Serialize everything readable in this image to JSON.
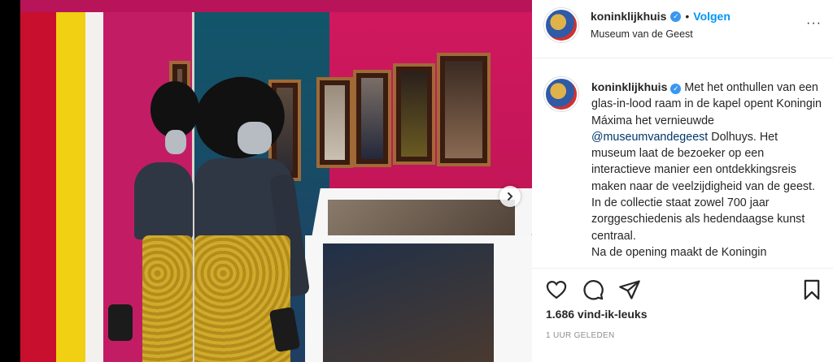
{
  "post": {
    "username": "koninklijkhuis",
    "verified": true,
    "follow_label": "Volgen",
    "separator": "•",
    "location": "Museum van de Geest",
    "more_label": "···"
  },
  "caption": {
    "username": "koninklijkhuis",
    "text_before": " Met het onthullen van een glas-in-lood raam in de kapel opent Koningin Máxima het vernieuwde ",
    "mention": "@museumvandegeest",
    "text_after": " Dolhuys. Het museum laat de bezoeker op een interactieve manier een ontdekkingsreis maken naar de veelzijdigheid van de geest. In de collectie staat zowel 700 jaar zorggeschiedenis als hedendaagse kunst centraal.",
    "text_cut": "Na de opening maakt de Koningin"
  },
  "actions": {
    "icons": [
      "heart-icon",
      "comment-icon",
      "share-icon",
      "bookmark-icon"
    ]
  },
  "likes": "1.686 vind-ik-leuks",
  "timestamp": "1 uur geleden",
  "colors": {
    "link_blue": "#0095f6",
    "mention_blue": "#00376b",
    "text": "#262626",
    "muted": "#8e8e8e",
    "verified": "#3897f0"
  }
}
